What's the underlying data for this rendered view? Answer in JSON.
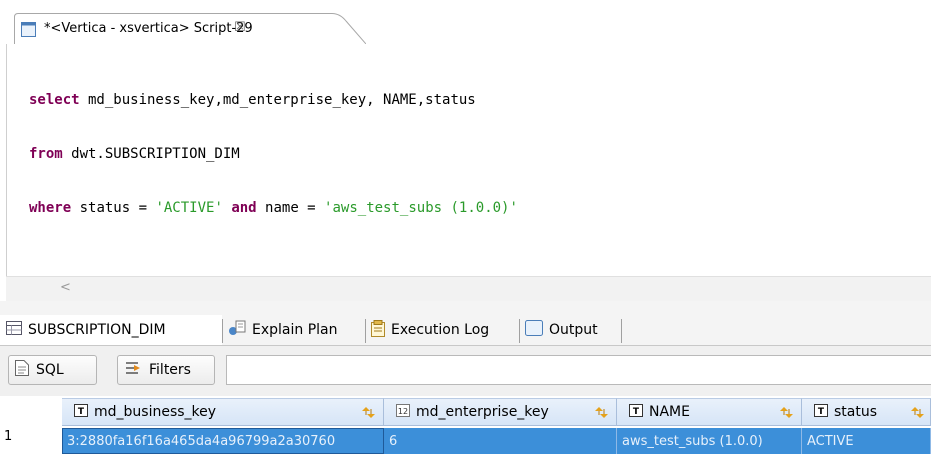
{
  "editor": {
    "tab_title": "*<Vertica - xsvertica> Script-29",
    "tab_close": "☒",
    "code": {
      "line1": {
        "kw": "select",
        "rest": " md_business_key,md_enterprise_key, NAME,status"
      },
      "line2": {
        "kw": "from",
        "rest": " dwt.SUBSCRIPTION_DIM"
      },
      "line3": {
        "kw1": "where",
        "mid1": " status = ",
        "str1": "'ACTIVE'",
        "kw2": " and",
        "mid2": " name = ",
        "str2": "'aws_test_subs (1.0.0)'"
      }
    },
    "scroll_left": "<"
  },
  "results": {
    "tabs": [
      {
        "label": "SUBSCRIPTION_DIM",
        "icon": "table-icon"
      },
      {
        "label": "Explain Plan",
        "icon": "explain-plan-icon"
      },
      {
        "label": "Execution Log",
        "icon": "execution-log-icon"
      },
      {
        "label": "Output",
        "icon": "output-icon"
      }
    ],
    "toolbar": {
      "sql_label": "SQL",
      "filters_label": "Filters",
      "filter_value": ""
    },
    "columns": [
      {
        "label": "md_business_key",
        "type_icon": "text-type-icon"
      },
      {
        "label": "md_enterprise_key",
        "type_icon": "number-type-icon"
      },
      {
        "label": "NAME",
        "type_icon": "text-type-icon"
      },
      {
        "label": "status",
        "type_icon": "text-type-icon"
      }
    ],
    "rows": [
      {
        "num": "1",
        "cells": [
          "3:2880fa16f16a465da4a96799a2a30760",
          "6",
          "aws_test_subs (1.0.0)",
          "ACTIVE"
        ]
      }
    ]
  },
  "colors": {
    "keyword": "#7f0055",
    "string": "#2a9a2a",
    "selection": "#3c8fd9",
    "header": "#d6e5f7"
  }
}
